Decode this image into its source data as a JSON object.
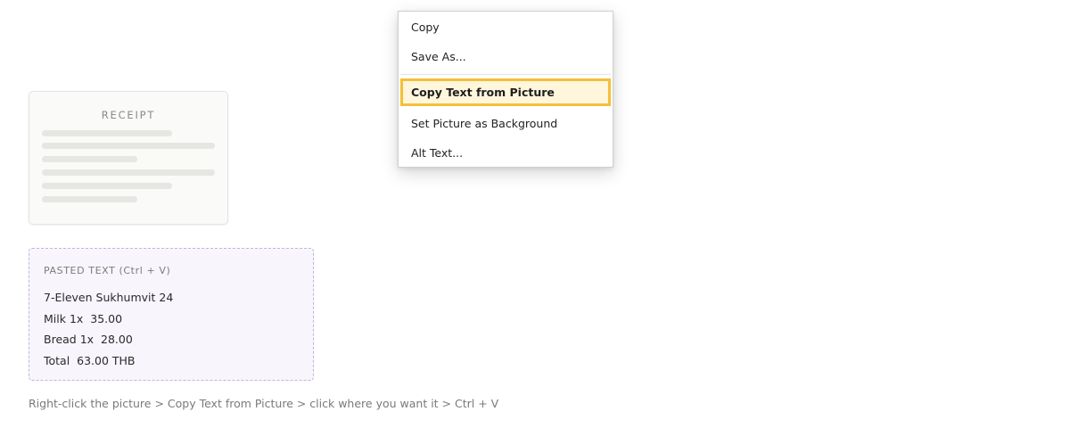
{
  "receipt": {
    "title": "RECEIPT"
  },
  "pasted": {
    "label": "PASTED TEXT (Ctrl + V)",
    "lines": [
      "7-Eleven Sukhumvit 24",
      "Milk 1x  35.00",
      "Bread 1x  28.00",
      "Total  63.00 THB"
    ]
  },
  "caption": "Right-click the picture > Copy Text from Picture > click where you want it > Ctrl + V",
  "context_menu": {
    "items": [
      {
        "label": "Copy"
      },
      {
        "label": "Save As..."
      },
      {
        "label": "Copy Text from Picture",
        "highlighted": true
      },
      {
        "label": "Set Picture as Background"
      },
      {
        "label": "Alt Text..."
      }
    ]
  },
  "colors": {
    "highlight_border": "#f4bf3a",
    "highlight_fill": "#fff6dc",
    "pasted_border": "#c3b3dc",
    "pasted_fill": "#f8f5fc"
  }
}
